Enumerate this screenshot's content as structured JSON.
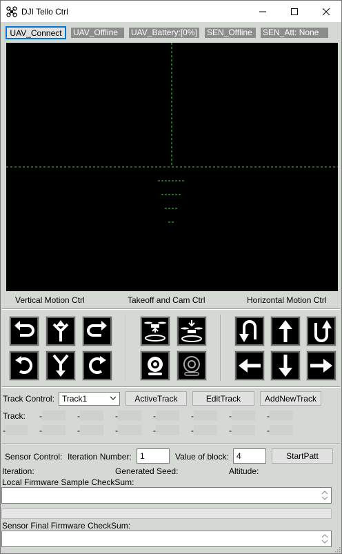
{
  "window": {
    "title": "DJI Tello Ctrl"
  },
  "status_row": {
    "connect_button": "UAV_Connect",
    "uav_status": "UAV_Offline",
    "uav_battery": "UAV_Battery:[0%]",
    "sensor_status": "SEN_Offline",
    "sensor_att": "SEN_Att: None"
  },
  "panels": {
    "vertical_label": "Vertical Motion Ctrl",
    "takeoff_label": "Takeoff and Cam Ctrl",
    "horizontal_label": "Horizontal Motion Ctrl"
  },
  "vertical_icons": [
    "rotate-ccw-icon",
    "split-up-icon",
    "rotate-cw-icon",
    "flip-back-icon",
    "merge-down-icon",
    "flip-forward-icon"
  ],
  "takeoff_icons": [
    "drone-takeoff-icon",
    "drone-land-icon",
    "camera-icon",
    "camera-off-icon"
  ],
  "horizontal_icons": [
    "u-turn-down-icon",
    "arrow-up-icon",
    "u-turn-up-icon",
    "arrow-left-icon",
    "arrow-down-icon",
    "arrow-right-icon"
  ],
  "track": {
    "control_label": "Track Control:",
    "selected": "Track1",
    "active_button": "ActiveTrack",
    "edit_button": "EditTrack",
    "add_button": "AddNewTrack",
    "row1_label": "Track:",
    "row1_cells": [
      "-",
      "-",
      "-",
      "-",
      "-",
      "-",
      "-"
    ],
    "row2_label": "-",
    "row2_cells": [
      "-",
      "-",
      "-",
      "-",
      "-",
      "-",
      "-"
    ]
  },
  "sensor": {
    "control_label": "Sensor Control:",
    "iteration_label": "Iteration Number:",
    "iteration_value": "1",
    "block_label": "Value of block:",
    "block_value": "4",
    "start_button": "StartPatt",
    "iteration_info": "Iteration:",
    "seed_info": "Generated Seed:",
    "altitude_info": "Altitude:",
    "local_checksum_label": "Local Firmware Sample CheckSum:",
    "final_checksum_label": "Sensor Final Firmware CheckSum:",
    "progress": 0
  },
  "colors": {
    "window_bg": "#d4d9d3",
    "video_bg": "#000000",
    "crosshair": "#3cd23c",
    "status_bg": "#8c8c8c",
    "focus_border": "#0078d7"
  }
}
